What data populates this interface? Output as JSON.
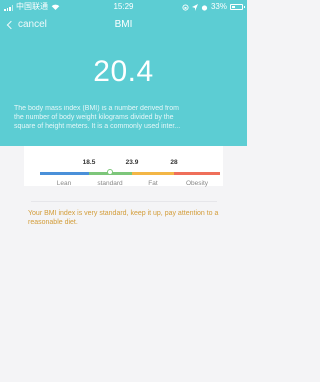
{
  "status_bar": {
    "carrier": "中国联通",
    "time": "15:29",
    "battery": "33%"
  },
  "nav": {
    "back_label": "cancel",
    "title": "BMI"
  },
  "bmi": {
    "value": "20.4"
  },
  "description": {
    "line1": "The body mass index (BMI) is a number derived from",
    "line2": "the number of body weight kilograms divided by the",
    "line3": "square of height meters. It is a commonly used inter..."
  },
  "scale": {
    "thresholds": [
      "18.5",
      "23.9",
      "28"
    ],
    "categories": [
      "Lean",
      "standard",
      "Fat",
      "Obesity"
    ],
    "colors": [
      "#4a90d9",
      "#7dc67a",
      "#f3b646",
      "#ef6f5a"
    ],
    "current_category": "standard"
  },
  "advice": "Your BMI index is very standard, keep it up, pay attention to a reasonable diet."
}
